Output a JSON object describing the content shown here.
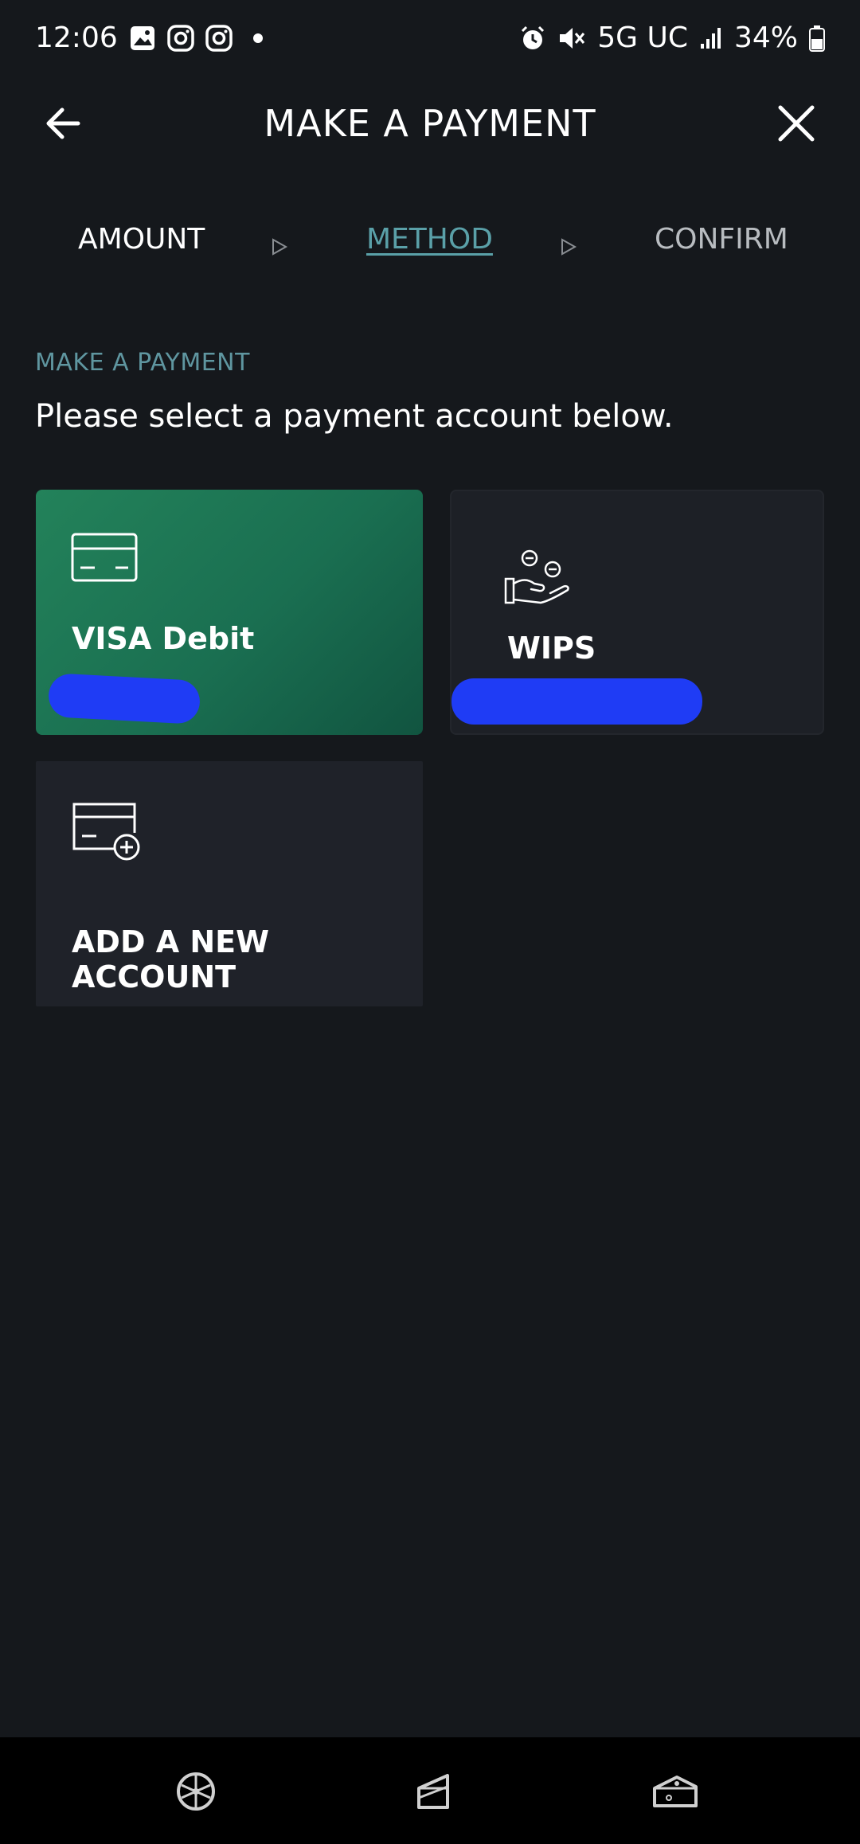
{
  "status_bar": {
    "time": "12:06",
    "network": "5G UC",
    "battery": "34%",
    "left_icons": [
      "gallery-icon",
      "instagram-icon",
      "instagram-icon",
      "dot-icon"
    ],
    "right_icons": [
      "alarm-icon",
      "mute-icon",
      "signal-icon",
      "battery-icon"
    ]
  },
  "header": {
    "title": "MAKE A PAYMENT",
    "back_icon": "back-arrow-icon",
    "close_icon": "close-icon"
  },
  "steps": [
    {
      "label": "AMOUNT",
      "state": "done"
    },
    {
      "label": "METHOD",
      "state": "active"
    },
    {
      "label": "CONFIRM",
      "state": "pending"
    }
  ],
  "section": {
    "label": "MAKE A PAYMENT",
    "text": "Please select a payment account below."
  },
  "accounts": [
    {
      "title": "VISA Debit",
      "icon": "credit-card-icon",
      "subtitle_redacted": true,
      "selected": true
    },
    {
      "title": "WIPS",
      "icon": "hand-coins-icon",
      "subtitle_redacted": true,
      "selected": false
    }
  ],
  "add_account": {
    "title": "ADD A NEW ACCOUNT",
    "icon": "add-card-icon"
  },
  "colors": {
    "background": "#15181c",
    "accent": "#5aa0a8",
    "selected_card": "#1f7a55",
    "card": "#1d2026",
    "redaction": "#1f3cf5"
  },
  "bottom_nav": {
    "items": [
      "wheel-icon",
      "cake-slice-icon",
      "cheese-icon"
    ]
  }
}
